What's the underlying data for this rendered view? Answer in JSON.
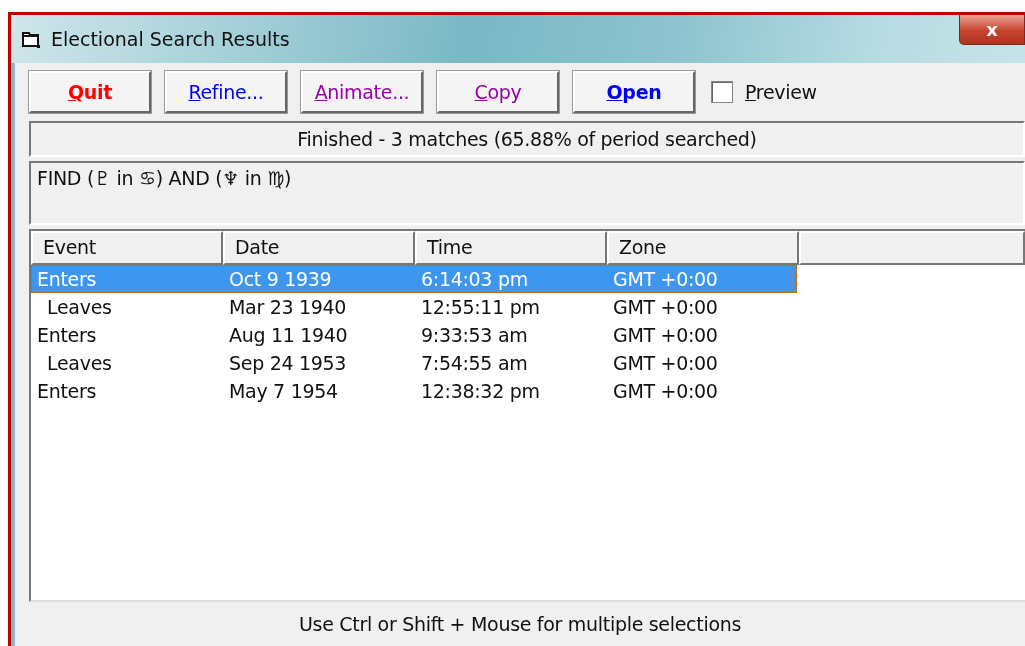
{
  "window": {
    "title": "Electional Search Results",
    "close": "x"
  },
  "toolbar": {
    "buttons": [
      {
        "label": "Quit",
        "color": "#ff0000",
        "bold": true
      },
      {
        "label": "Refine...",
        "color": "#0000ff",
        "bold": false
      },
      {
        "label": "Animate...",
        "color": "#9900aa",
        "bold": false
      },
      {
        "label": "Copy",
        "color": "#9900aa",
        "bold": false
      },
      {
        "label": "Open",
        "color": "#0000ff",
        "bold": true
      }
    ],
    "preview": {
      "label": "Preview",
      "checked": false
    }
  },
  "status": "Finished - 3 matches  (65.88% of period searched)",
  "query": "FIND  (♇ in ♋) AND  (♆ in ♍)",
  "table": {
    "columns": [
      "Event",
      "Date",
      "Time",
      "Zone"
    ],
    "rows": [
      {
        "event": "Enters",
        "date": "Oct 9 1939",
        "time": "6:14:03 pm",
        "zone": "GMT +0:00",
        "selected": true,
        "children": [
          {
            "event": "Leaves",
            "date": "Mar 23 1940",
            "time": "12:55:11 pm",
            "zone": "GMT +0:00",
            "selected": false
          }
        ]
      },
      {
        "event": "Enters",
        "date": "Aug 11 1940",
        "time": "9:33:53 am",
        "zone": "GMT +0:00",
        "selected": false,
        "children": [
          {
            "event": "Leaves",
            "date": "Sep 24 1953",
            "time": "7:54:55 am",
            "zone": "GMT +0:00",
            "selected": false
          }
        ]
      },
      {
        "event": "Enters",
        "date": "May 7 1954",
        "time": "12:38:32 pm",
        "zone": "GMT +0:00",
        "selected": false
      }
    ]
  },
  "footer": "Use Ctrl or Shift + Mouse for multiple selections"
}
